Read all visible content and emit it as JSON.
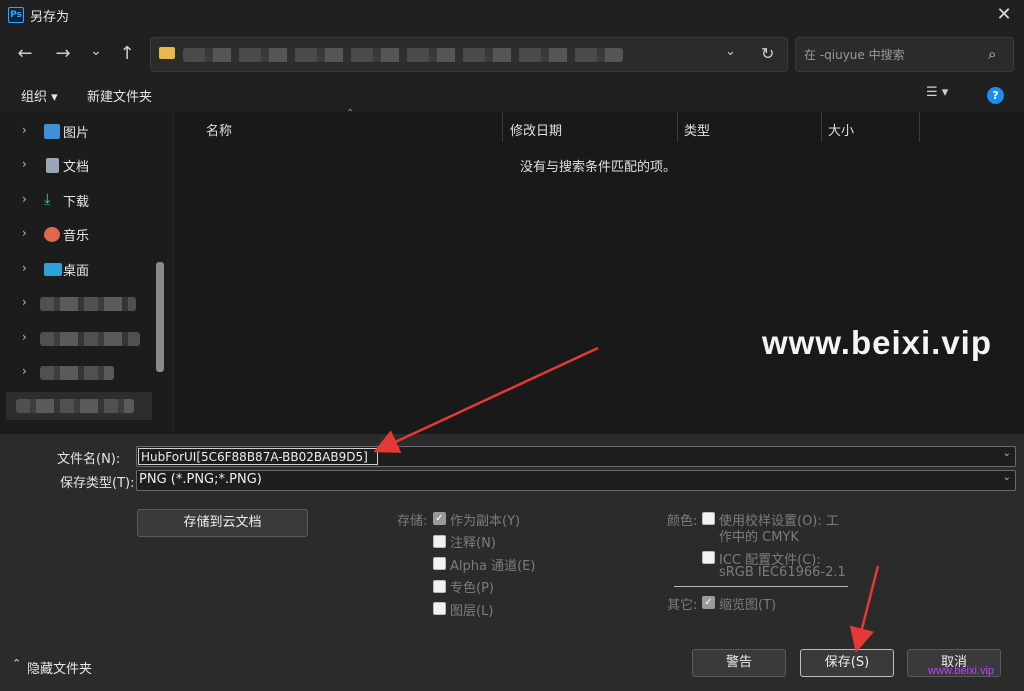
{
  "window": {
    "title": "另存为",
    "app_icon": "Ps",
    "close_glyph": "✕"
  },
  "nav": {
    "back_icon": "←",
    "forward_icon": "→",
    "dropdown_icon": "⌄",
    "up_icon": "↑",
    "address_dropdown_icon": "⌄",
    "refresh_icon": "↻",
    "search_placeholder": "在 -qiuyue 中搜索",
    "search_icon_glyph": "⌕"
  },
  "toolbar": {
    "organize": "组织 ▾",
    "new_folder": "新建文件夹",
    "view_icon": "☰ ▾",
    "help_glyph": "?"
  },
  "sidebar": {
    "items": [
      {
        "label": "图片",
        "icon": "pictures-icon",
        "color": "#3d8fd6"
      },
      {
        "label": "文档",
        "icon": "documents-icon",
        "color": "#9aa6b8"
      },
      {
        "label": "下载",
        "icon": "downloads-icon",
        "color": "#3cc98a"
      },
      {
        "label": "音乐",
        "icon": "music-icon",
        "color": "#e0674e"
      },
      {
        "label": "桌面",
        "icon": "desktop-icon",
        "color": "#2aa3d8"
      }
    ],
    "chevron": "›"
  },
  "filelist": {
    "columns": [
      "名称",
      "修改日期",
      "类型",
      "大小"
    ],
    "empty_message": "没有与搜索条件匹配的项。",
    "sort_indicator": "⌃"
  },
  "watermark": {
    "text": "www.beixi.vip",
    "small_text": "www.beixi.vip"
  },
  "form": {
    "filename_label": "文件名(N):",
    "filename_value": "HubForUI[5C6F88B87A-BB02BAB9D5]",
    "filetype_label": "保存类型(T):",
    "filetype_value": "PNG (*.PNG;*.PNG)",
    "combo_arrow": "⌄",
    "cloud_button": "存储到云文档"
  },
  "save_options": {
    "storage_label": "存储:",
    "as_copy": "作为副本(Y)",
    "notes": "注释(N)",
    "alpha": "Alpha 通道(E)",
    "spot": "专色(P)",
    "layers": "图层(L)",
    "color_label": "颜色:",
    "use_proof": "使用校样设置(O):  工",
    "use_proof_2": "作中的 CMYK",
    "icc": "ICC 配置文件(C):",
    "icc_2": "sRGB IEC61966-2.1",
    "other_label": "其它:",
    "thumbnail": "缩览图(T)",
    "check_glyph": "✓"
  },
  "buttons": {
    "warning": "警告",
    "save": "保存(S)",
    "cancel": "取消"
  },
  "footer": {
    "hide_folders": "隐藏文件夹",
    "hide_icon": "⌃"
  },
  "colors": {
    "accent_blue": "#1a8ef0",
    "annotation_red": "#e53935",
    "watermark_purple": "#c040ff"
  }
}
